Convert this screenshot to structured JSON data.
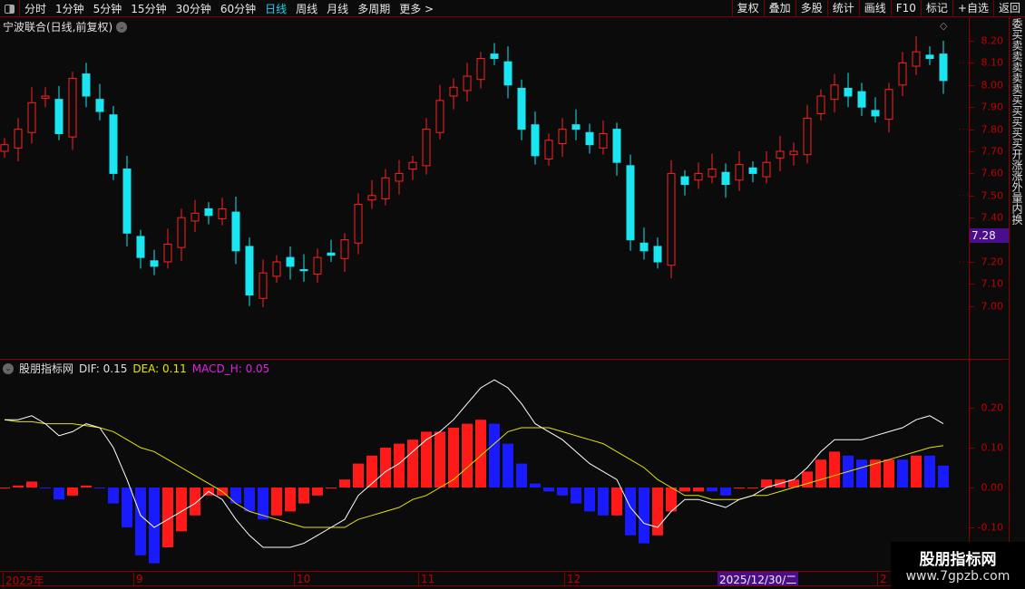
{
  "toolbar": {
    "periods": [
      "分时",
      "1分钟",
      "5分钟",
      "15分钟",
      "30分钟",
      "60分钟",
      "日线",
      "周线",
      "月线",
      "多周期",
      "更多 >"
    ],
    "active_period": "日线",
    "buttons": [
      "复权",
      "叠加",
      "多股",
      "统计",
      "画线",
      "F10",
      "标记",
      "+自选",
      "返回"
    ]
  },
  "chart_title": "宁波联合(日线,前复权)",
  "colors": {
    "up": "#ff2020",
    "down": "#19e6f0",
    "dif": "#ffffff",
    "dea": "#e6e600",
    "hist_up": "#ff1a1a",
    "hist_down": "#1a1aff",
    "axis": "#c00000",
    "highlight": "#4a0e8c"
  },
  "price_axis": {
    "labels": [
      "8.20",
      "8.10",
      "8.00",
      "7.90",
      "7.80",
      "7.70",
      "7.60",
      "7.50",
      "7.40",
      "7.20",
      "7.10",
      "7.00"
    ],
    "current_price": "7.28"
  },
  "indicator": {
    "name": "股朋指标网",
    "dif": "DIF: 0.15",
    "dea": "DEA: 0.11",
    "macd_h": "MACD_H: 0.05",
    "axis_labels": [
      "0.20",
      "0.10",
      "0.00",
      "-0.10"
    ]
  },
  "side_panel_text": "委买卖卖卖卖卖买买买买买开涨涨外量内换",
  "date_axis": {
    "labels": [
      "2025年",
      "9",
      "10",
      "11",
      "12",
      "2"
    ],
    "cursor_date": "2025/12/30/二"
  },
  "watermark": {
    "line1": "股朋指标网",
    "line2": "www.7gpzb.com"
  },
  "chart_data": [
    {
      "type": "candlestick",
      "ylim": [
        6.9,
        8.25
      ],
      "close": [
        7.73,
        7.8,
        7.92,
        7.95,
        7.78,
        8.03,
        7.95,
        7.88,
        7.6,
        7.33,
        7.22,
        7.18,
        7.28,
        7.4,
        7.42,
        7.41,
        7.44,
        7.25,
        7.05,
        7.15,
        7.2,
        7.18,
        7.16,
        7.22,
        7.23,
        7.3,
        7.46,
        7.5,
        7.58,
        7.6,
        7.65,
        7.8,
        7.93,
        7.99,
        8.04,
        8.12,
        8.12,
        8.0,
        7.8,
        7.68,
        7.75,
        7.8,
        7.8,
        7.73,
        7.78,
        7.65,
        7.3,
        7.25,
        7.2,
        7.6,
        7.55,
        7.6,
        7.62,
        7.55,
        7.64,
        7.6,
        7.65,
        7.7,
        7.7,
        7.85,
        7.95,
        8.0,
        7.95,
        7.9,
        7.86,
        7.98,
        8.1,
        8.15,
        8.12,
        8.02
      ]
    },
    {
      "type": "macd",
      "ylim": [
        -0.2,
        0.3
      ],
      "dif": [
        0.17,
        0.17,
        0.18,
        0.16,
        0.13,
        0.14,
        0.16,
        0.15,
        0.1,
        0.02,
        -0.07,
        -0.1,
        -0.08,
        -0.06,
        -0.04,
        -0.01,
        -0.03,
        -0.08,
        -0.12,
        -0.15,
        -0.15,
        -0.15,
        -0.14,
        -0.12,
        -0.1,
        -0.08,
        -0.02,
        0.01,
        0.04,
        0.06,
        0.09,
        0.12,
        0.14,
        0.17,
        0.21,
        0.25,
        0.27,
        0.25,
        0.21,
        0.16,
        0.14,
        0.12,
        0.09,
        0.06,
        0.04,
        0.02,
        -0.05,
        -0.09,
        -0.1,
        -0.06,
        -0.03,
        -0.03,
        -0.04,
        -0.05,
        -0.03,
        -0.02,
        0,
        0.01,
        0.02,
        0.05,
        0.09,
        0.12,
        0.12,
        0.12,
        0.13,
        0.14,
        0.15,
        0.17,
        0.18,
        0.16
      ],
      "dea": [
        0.17,
        0.165,
        0.165,
        0.16,
        0.16,
        0.16,
        0.155,
        0.15,
        0.14,
        0.12,
        0.1,
        0.09,
        0.07,
        0.05,
        0.03,
        0.01,
        -0.01,
        -0.04,
        -0.06,
        -0.07,
        -0.08,
        -0.09,
        -0.1,
        -0.1,
        -0.1,
        -0.1,
        -0.08,
        -0.07,
        -0.06,
        -0.05,
        -0.03,
        -0.02,
        0,
        0.02,
        0.05,
        0.08,
        0.11,
        0.14,
        0.15,
        0.15,
        0.15,
        0.14,
        0.13,
        0.12,
        0.11,
        0.09,
        0.07,
        0.05,
        0.02,
        0,
        -0.02,
        -0.02,
        -0.03,
        -0.03,
        -0.03,
        -0.02,
        -0.02,
        -0.01,
        0,
        0.01,
        0.02,
        0.03,
        0.04,
        0.05,
        0.06,
        0.07,
        0.08,
        0.09,
        0.1,
        0.105
      ]
    }
  ]
}
